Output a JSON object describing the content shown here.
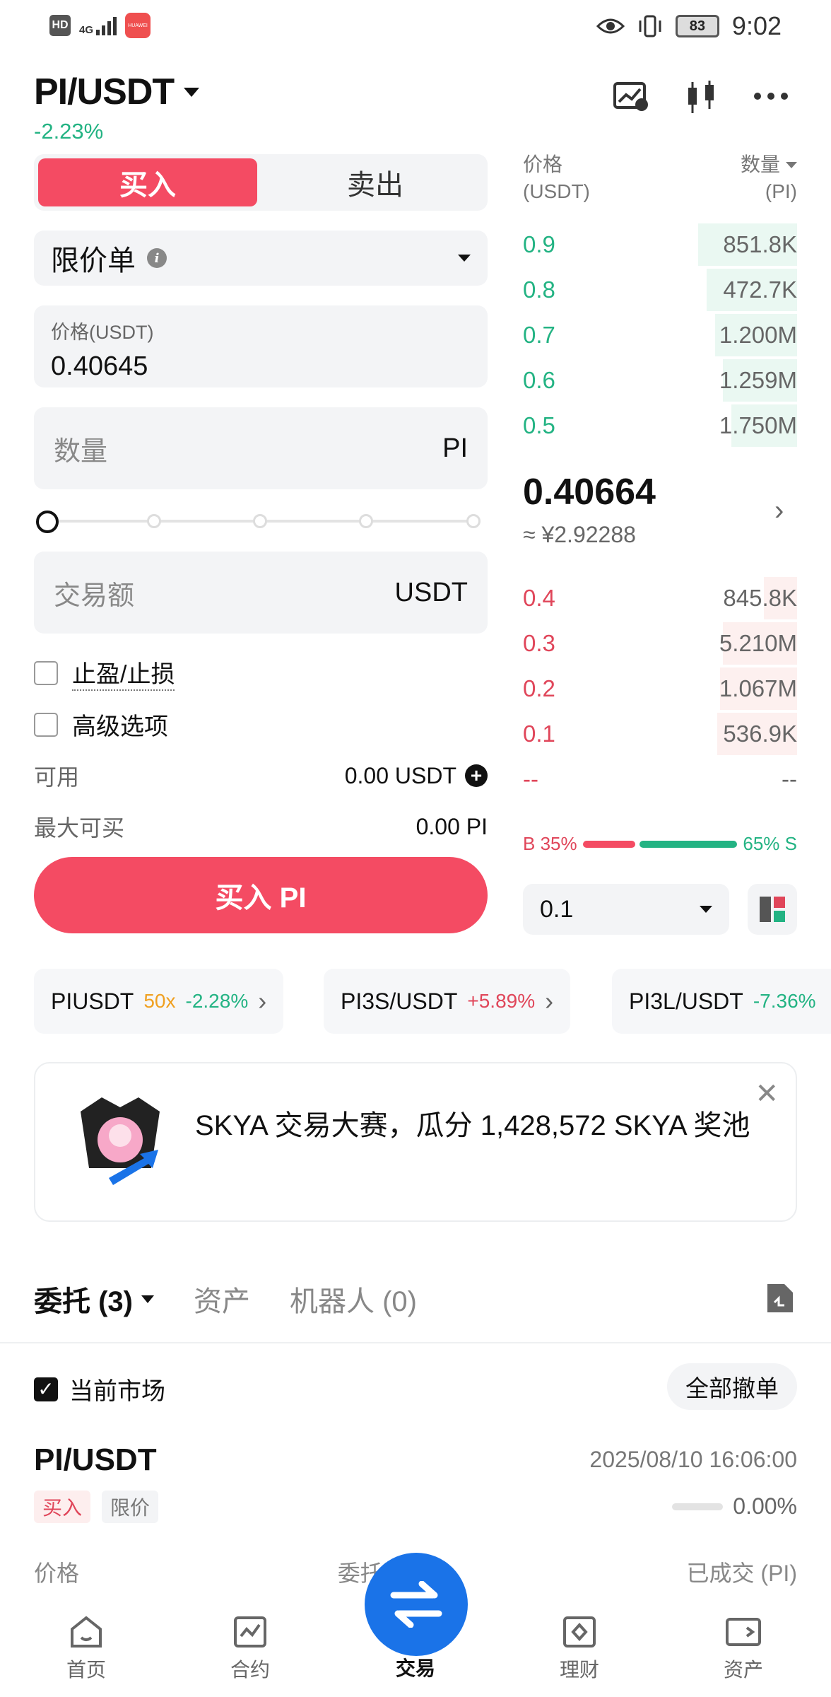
{
  "status_bar": {
    "hd": "HD",
    "network": "4G",
    "app_badge": "HUAWEI",
    "battery": "83",
    "time": "9:02"
  },
  "header": {
    "pair": "PI/USDT",
    "change": "-2.23%",
    "icons": [
      "chart-settings-icon",
      "candlestick-icon",
      "more-icon"
    ]
  },
  "trade_form": {
    "buy_tab": "买入",
    "sell_tab": "卖出",
    "order_type": "限价单",
    "price_label": "价格(USDT)",
    "price_value": "0.40645",
    "qty_placeholder": "数量",
    "qty_unit": "PI",
    "slider_value": 0,
    "amount_placeholder": "交易额",
    "amount_unit": "USDT",
    "tp_sl": "止盈/止损",
    "advanced": "高级选项",
    "available_label": "可用",
    "available_value": "0.00 USDT",
    "max_buy_label": "最大可买",
    "max_buy_value": "0.00 PI",
    "buy_button": "买入 PI"
  },
  "order_book": {
    "price_header_1": "价格",
    "price_header_2": "(USDT)",
    "qty_header_1": "数量",
    "qty_header_2": "(PI)",
    "asks": [
      {
        "price": "0.9",
        "qty": "851.8K",
        "depth": 0.36
      },
      {
        "price": "0.8",
        "qty": "472.7K",
        "depth": 0.33
      },
      {
        "price": "0.7",
        "qty": "1.200M",
        "depth": 0.3
      },
      {
        "price": "0.6",
        "qty": "1.259M",
        "depth": 0.27
      },
      {
        "price": "0.5",
        "qty": "1.750M",
        "depth": 0.24
      }
    ],
    "last_price": "0.40664",
    "last_price_cny": "≈ ¥2.92288",
    "bids": [
      {
        "price": "0.4",
        "qty": "845.8K",
        "depth": 0.12
      },
      {
        "price": "0.3",
        "qty": "5.210M",
        "depth": 0.27
      },
      {
        "price": "0.2",
        "qty": "1.067M",
        "depth": 0.28
      },
      {
        "price": "0.1",
        "qty": "536.9K",
        "depth": 0.29
      },
      {
        "price": "--",
        "qty": "--",
        "depth": 0
      }
    ],
    "buy_ratio_label": "B 35%",
    "sell_ratio_label": "65% S",
    "buy_ratio": 0.35,
    "sell_ratio": 0.65,
    "depth_value": "0.1"
  },
  "market_chips": [
    {
      "name": "PIUSDT",
      "leverage": "50x",
      "change": "-2.28%"
    },
    {
      "name": "PI3S/USDT",
      "change": "+5.89%"
    },
    {
      "name": "PI3L/USDT",
      "change": "-7.36%"
    }
  ],
  "banner": {
    "text": "SKYA 交易大赛，瓜分 1,428,572 SKYA 奖池"
  },
  "orders": {
    "tab_orders": "委托 (3)",
    "tab_assets": "资产",
    "tab_bots": "机器人 (0)",
    "current_market": "当前市场",
    "cancel_all": "全部撤单",
    "pair": "PI/USDT",
    "time": "2025/08/10 16:06:00",
    "tag_side": "买入",
    "tag_type": "限价",
    "filled_pct": "0.00%",
    "filled_ratio": 0,
    "col_price": "价格",
    "col_qty": "委托数量",
    "col_filled": "已成交 (PI)"
  },
  "bottom_nav": {
    "home": "首页",
    "futures": "合约",
    "trade": "交易",
    "finance": "理财",
    "assets": "资产"
  },
  "colors": {
    "buy_red": "#f44b63",
    "up_green": "#23b383",
    "fab_blue": "#1a73e8"
  }
}
